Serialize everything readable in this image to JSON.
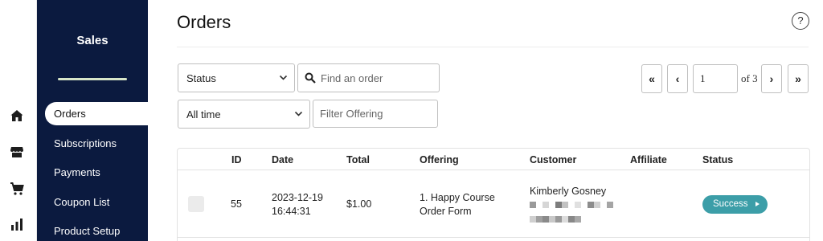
{
  "sidebar": {
    "title": "Sales",
    "items": [
      {
        "label": "Orders",
        "active": true
      },
      {
        "label": "Subscriptions",
        "active": false
      },
      {
        "label": "Payments",
        "active": false
      },
      {
        "label": "Coupon List",
        "active": false
      },
      {
        "label": "Product Setup",
        "active": false
      }
    ]
  },
  "rail": {
    "icons": [
      "home-icon",
      "store-icon",
      "cart-icon",
      "bar-chart-icon"
    ]
  },
  "header": {
    "title": "Orders",
    "help_label": "?"
  },
  "filters": {
    "status_select": "Status",
    "search_placeholder": "Find an order",
    "time_select": "All time",
    "offering_placeholder": "Filter Offering"
  },
  "pagination": {
    "first_label": "«",
    "prev_label": "‹",
    "current_page": "1",
    "of_total": "of 3",
    "next_label": "›",
    "last_label": "»"
  },
  "table": {
    "columns": [
      "ID",
      "Date",
      "Total",
      "Offering",
      "Customer",
      "Affiliate",
      "Status"
    ],
    "rows": [
      {
        "id": "55",
        "date_line1": "2023-12-19",
        "date_line2": "16:44:31",
        "total": "$1.00",
        "offering_line1": "1. Happy Course",
        "offering_line2": "Order Form",
        "customer_name": "Kimberly Gosney",
        "affiliate": "",
        "status": "Success"
      }
    ]
  },
  "colors": {
    "sidebar_bg": "#0b1a3f",
    "status_success": "#3c9ea8"
  }
}
